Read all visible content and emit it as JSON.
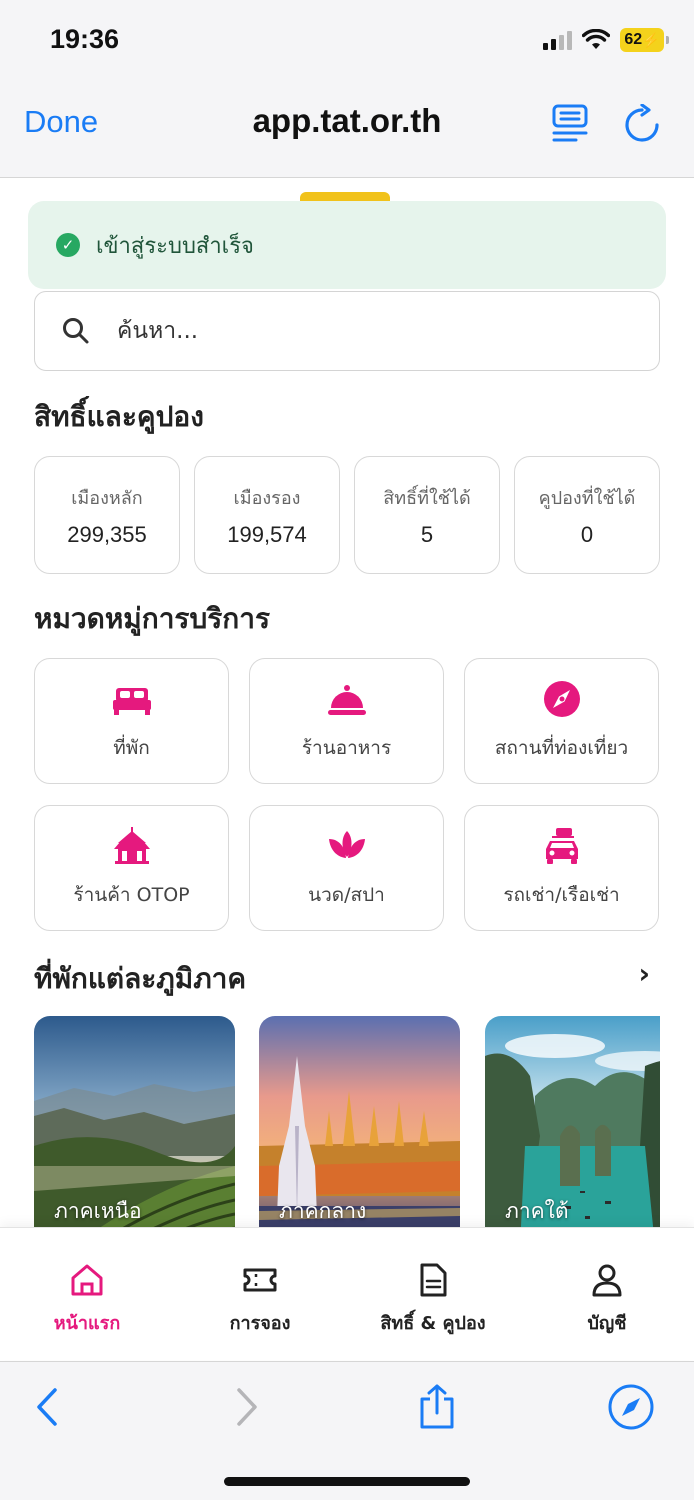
{
  "status_bar": {
    "time": "19:36",
    "battery": "62"
  },
  "browser": {
    "done_label": "Done",
    "url": "app.tat.or.th"
  },
  "toast": {
    "message": "เข้าสู่ระบบสำเร็จ",
    "color": "#27a862"
  },
  "search": {
    "placeholder": "ค้นหา..."
  },
  "rights_section": {
    "title": "สิทธิ์และคูปอง",
    "stats": [
      {
        "label": "เมืองหลัก",
        "value": "299,355"
      },
      {
        "label": "เมืองรอง",
        "value": "199,574"
      },
      {
        "label": "สิทธิ์ที่ใช้ได้",
        "value": "5"
      },
      {
        "label": "คูปองที่ใช้ได้",
        "value": "0"
      }
    ]
  },
  "categories_section": {
    "title": "หมวดหมู่การบริการ",
    "accent": "#e5197e",
    "items": [
      {
        "label": "ที่พัก",
        "icon": "bed-icon"
      },
      {
        "label": "ร้านอาหาร",
        "icon": "food-cloche-icon"
      },
      {
        "label": "สถานที่ท่องเที่ยว",
        "icon": "compass-icon"
      },
      {
        "label": "ร้านค้า OTOP",
        "icon": "thai-pavilion-icon"
      },
      {
        "label": "นวด/สปา",
        "icon": "lotus-icon"
      },
      {
        "label": "รถเช่า/เรือเช่า",
        "icon": "car-luggage-icon"
      }
    ]
  },
  "regions_section": {
    "title": "ที่พักแต่ละภูมิภาค",
    "items": [
      {
        "label": "ภาคเหนือ"
      },
      {
        "label": "ภาคกลาง"
      },
      {
        "label": "ภาคใต้"
      }
    ]
  },
  "tab_bar": {
    "active_color": "#e5197e",
    "items": [
      {
        "label": "หน้าแรก",
        "icon": "home-icon"
      },
      {
        "label": "การจอง",
        "icon": "ticket-icon"
      },
      {
        "label": "สิทธิ์ & คูปอง",
        "icon": "document-icon"
      },
      {
        "label": "บัญชี",
        "icon": "user-icon"
      }
    ]
  },
  "safari": {
    "accent": "#1a7cf5"
  }
}
